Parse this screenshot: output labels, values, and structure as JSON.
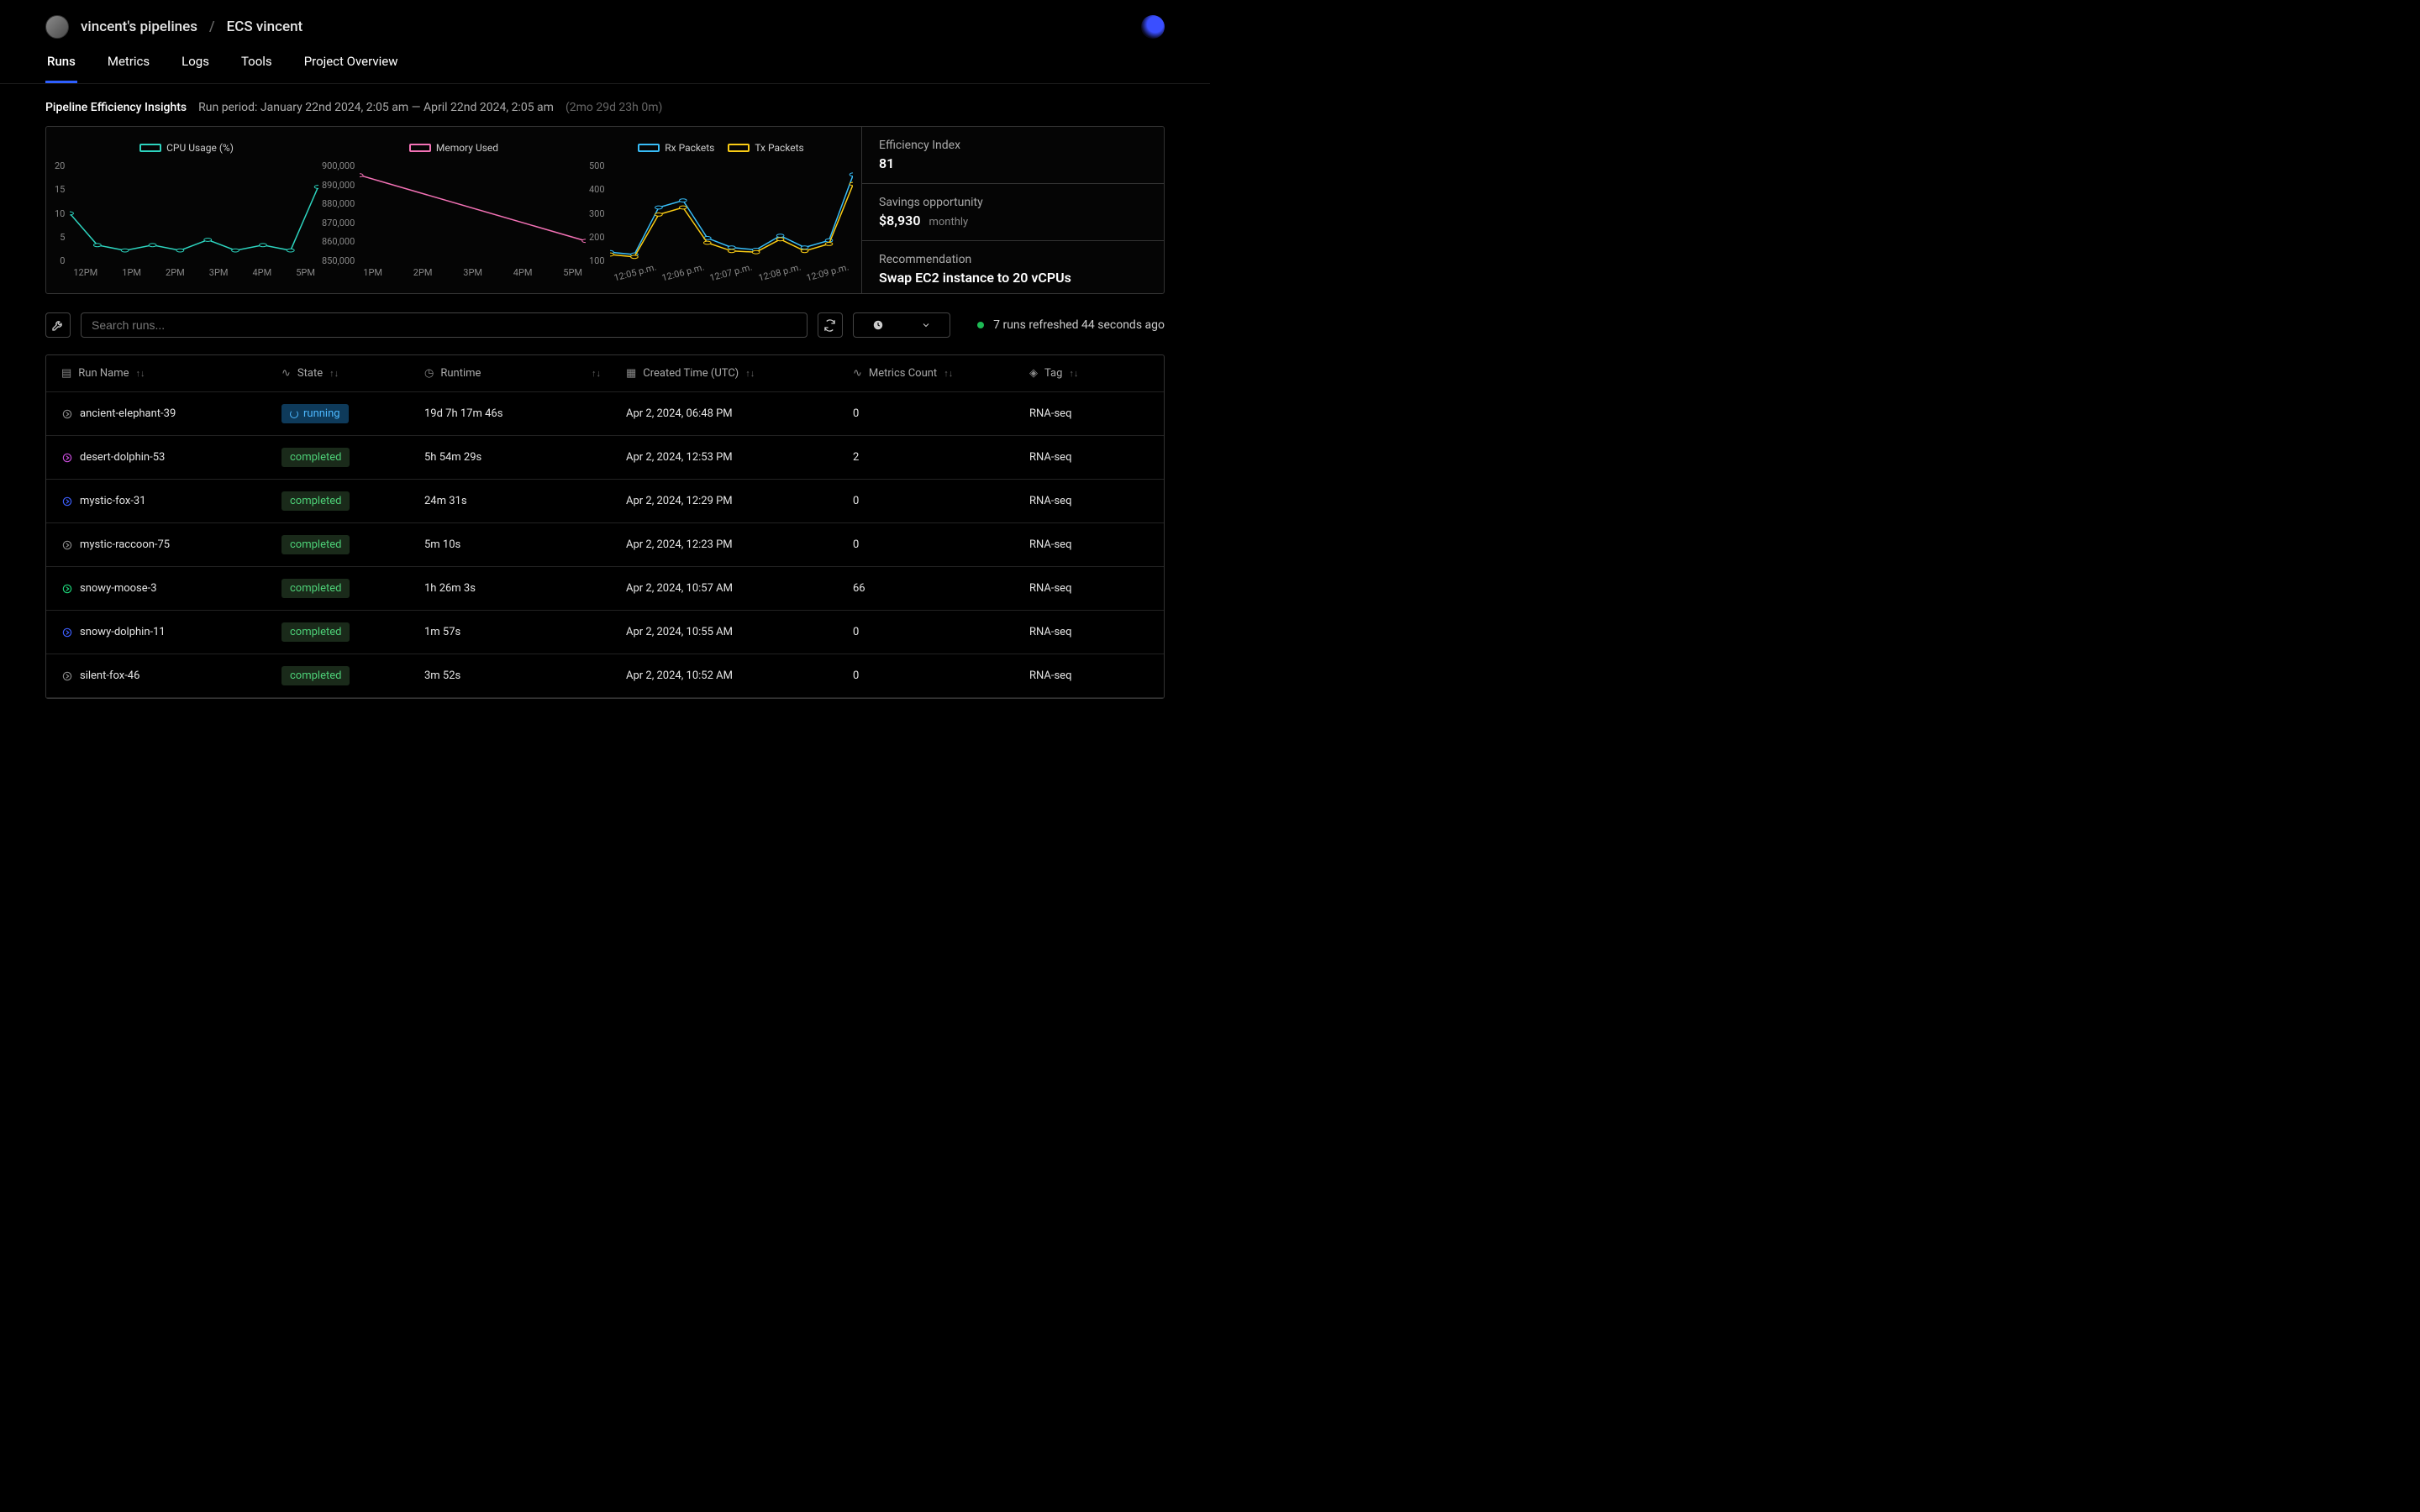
{
  "breadcrumb": {
    "root": "vincent's pipelines",
    "current": "ECS vincent"
  },
  "tabs": [
    "Runs",
    "Metrics",
    "Logs",
    "Tools",
    "Project Overview"
  ],
  "active_tab": 0,
  "insights": {
    "title": "Pipeline Efficiency Insights",
    "period": "Run period: January 22nd 2024, 2:05 am — April 22nd 2024, 2:05 am",
    "duration": "(2mo 29d 23h 0m)"
  },
  "kpis": {
    "efficiency_label": "Efficiency Index",
    "efficiency_value": "81",
    "savings_label": "Savings opportunity",
    "savings_value": "$8,930",
    "savings_sub": "monthly",
    "rec_label": "Recommendation",
    "rec_value": "Swap EC2 instance to 20 vCPUs"
  },
  "search_placeholder": "Search runs...",
  "refresh_status": "7 runs refreshed 44 seconds ago",
  "columns": {
    "name": "Run Name",
    "state": "State",
    "runtime": "Runtime",
    "created": "Created Time (UTC)",
    "metrics": "Metrics Count",
    "tag": "Tag"
  },
  "rows": [
    {
      "icon_color": "#888",
      "name": "ancient-elephant-39",
      "state": "running",
      "runtime": "19d 7h 17m 46s",
      "created": "Apr 2, 2024, 06:48 PM",
      "metrics": "0",
      "tag": "RNA-seq"
    },
    {
      "icon_color": "#c94ddc",
      "name": "desert-dolphin-53",
      "state": "completed",
      "runtime": "5h 54m 29s",
      "created": "Apr 2, 2024, 12:53 PM",
      "metrics": "2",
      "tag": "RNA-seq"
    },
    {
      "icon_color": "#3d5fff",
      "name": "mystic-fox-31",
      "state": "completed",
      "runtime": "24m 31s",
      "created": "Apr 2, 2024, 12:29 PM",
      "metrics": "0",
      "tag": "RNA-seq"
    },
    {
      "icon_color": "#888",
      "name": "mystic-raccoon-75",
      "state": "completed",
      "runtime": "5m 10s",
      "created": "Apr 2, 2024, 12:23 PM",
      "metrics": "0",
      "tag": "RNA-seq"
    },
    {
      "icon_color": "#1dd67a",
      "name": "snowy-moose-3",
      "state": "completed",
      "runtime": "1h 26m 3s",
      "created": "Apr 2, 2024, 10:57 AM",
      "metrics": "66",
      "tag": "RNA-seq"
    },
    {
      "icon_color": "#3d5fff",
      "name": "snowy-dolphin-11",
      "state": "completed",
      "runtime": "1m 57s",
      "created": "Apr 2, 2024, 10:55 AM",
      "metrics": "0",
      "tag": "RNA-seq"
    },
    {
      "icon_color": "#888",
      "name": "silent-fox-46",
      "state": "completed",
      "runtime": "3m 52s",
      "created": "Apr 2, 2024, 10:52 AM",
      "metrics": "0",
      "tag": "RNA-seq"
    }
  ],
  "chart_data": [
    {
      "type": "line",
      "title": "CPU Usage (%)",
      "series": [
        {
          "name": "CPU Usage (%)",
          "color": "#2dd4bf",
          "values": [
            10,
            4,
            3,
            4,
            3,
            5,
            3,
            4,
            3,
            15
          ]
        }
      ],
      "x_ticks": [
        "12PM",
        "1PM",
        "2PM",
        "3PM",
        "4PM",
        "5PM"
      ],
      "y_ticks": [
        0,
        5,
        10,
        15,
        20
      ],
      "ylim": [
        0,
        20
      ]
    },
    {
      "type": "line",
      "title": "Memory Used",
      "series": [
        {
          "name": "Memory Used",
          "color": "#f472b6",
          "values": [
            893000,
            862000
          ]
        }
      ],
      "x_ticks": [
        "1PM",
        "2PM",
        "3PM",
        "4PM",
        "5PM"
      ],
      "y_ticks": [
        850000,
        860000,
        870000,
        880000,
        890000,
        900000
      ],
      "y_tick_labels": [
        "850,000",
        "860,000",
        "870,000",
        "880,000",
        "890,000",
        "900,000"
      ],
      "ylim": [
        850000,
        900000
      ]
    },
    {
      "type": "line",
      "title": "Packets",
      "series": [
        {
          "name": "Rx Packets",
          "color": "#38bdf8",
          "values": [
            110,
            100,
            300,
            330,
            170,
            130,
            120,
            180,
            130,
            160,
            440
          ]
        },
        {
          "name": "Tx Packets",
          "color": "#facc15",
          "values": [
            100,
            90,
            270,
            300,
            150,
            115,
            110,
            165,
            115,
            145,
            400
          ]
        }
      ],
      "x_ticks": [
        "12:05 p.m.",
        "12:06 p.m.",
        "12:07 p.m.",
        "12:08 p.m.",
        "12:09 p.m."
      ],
      "y_ticks": [
        100,
        200,
        300,
        400,
        500
      ],
      "ylim": [
        50,
        500
      ]
    }
  ],
  "state_labels": {
    "running": "running",
    "completed": "completed"
  }
}
